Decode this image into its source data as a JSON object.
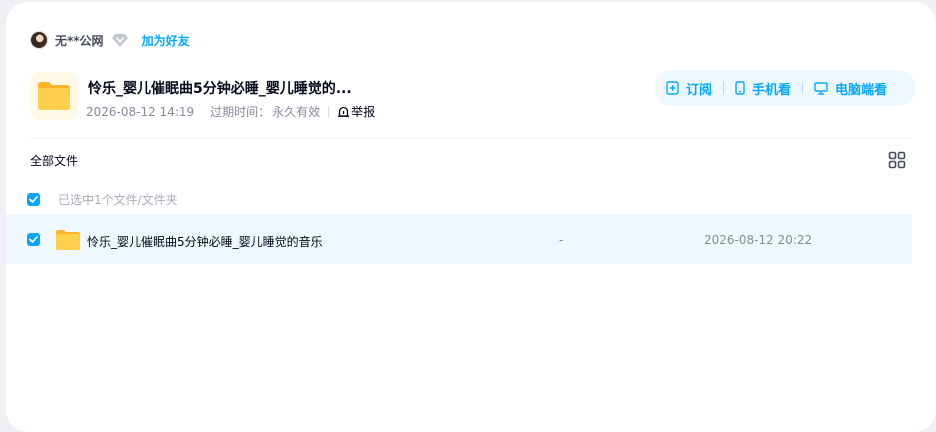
{
  "user": {
    "name": "无**公网",
    "add_friend_label": "加为好友"
  },
  "share": {
    "title": "怜乐_婴儿催眠曲5分钟必睡_婴儿睡觉的...",
    "created": "2026-08-12 14:19",
    "expire_label": "过期时间：",
    "expire_value": "永久有效",
    "report_label": "举报"
  },
  "actions": [
    {
      "label": "订阅",
      "icon": "subscribe-icon"
    },
    {
      "label": "手机看",
      "icon": "phone-icon"
    },
    {
      "label": "电脑端看",
      "icon": "monitor-icon"
    }
  ],
  "breadcrumb": "全部文件",
  "selection": {
    "text": "已选中1个文件/文件夹",
    "checked": true
  },
  "files": [
    {
      "name": "怜乐_婴儿催眠曲5分钟必睡_婴儿睡觉的音乐",
      "size": "-",
      "date": "2026-08-12 20:22",
      "checked": true,
      "icon": "folder-icon"
    }
  ],
  "colors": {
    "accent": "#06a7ff",
    "row_highlight": "#f0f8ff",
    "pill_bg": "#eef8ff",
    "folder": "#ffc53d"
  }
}
